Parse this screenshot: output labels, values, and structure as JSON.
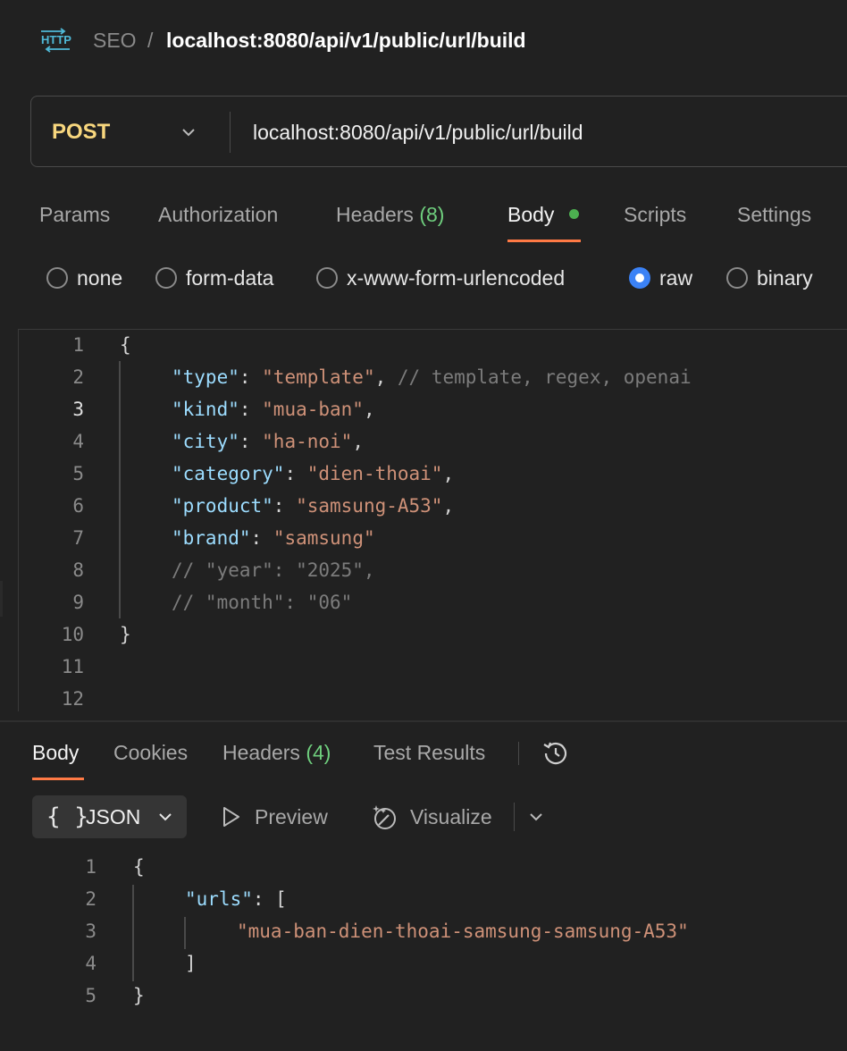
{
  "breadcrumb": {
    "icon_label": "HTTP",
    "parent": "SEO",
    "separator": "/",
    "current": "localhost:8080/api/v1/public/url/build"
  },
  "request": {
    "method": "POST",
    "url": "localhost:8080/api/v1/public/url/build"
  },
  "request_tabs": {
    "params": "Params",
    "authorization": "Authorization",
    "headers_label": "Headers",
    "headers_count": "(8)",
    "body": "Body",
    "scripts": "Scripts",
    "settings": "Settings",
    "active": "Body"
  },
  "body_types": {
    "options": [
      "none",
      "form-data",
      "x-www-form-urlencoded",
      "raw",
      "binary"
    ],
    "selected": "raw"
  },
  "request_body": {
    "line_numbers": [
      "1",
      "2",
      "3",
      "4",
      "5",
      "6",
      "7",
      "8",
      "9",
      "10",
      "11",
      "12"
    ],
    "active_line": "3",
    "lines": [
      [
        [
          "p",
          "{"
        ]
      ],
      [
        [
          "k",
          "\"type\""
        ],
        [
          "p",
          ": "
        ],
        [
          "s",
          "\"template\""
        ],
        [
          "p",
          ", "
        ],
        [
          "c",
          "// template, regex, openai"
        ]
      ],
      [
        [
          "k",
          "\"kind\""
        ],
        [
          "p",
          ": "
        ],
        [
          "s",
          "\"mua-ban\""
        ],
        [
          "p",
          ","
        ]
      ],
      [
        [
          "k",
          "\"city\""
        ],
        [
          "p",
          ": "
        ],
        [
          "s",
          "\"ha-noi\""
        ],
        [
          "p",
          ","
        ]
      ],
      [
        [
          "k",
          "\"category\""
        ],
        [
          "p",
          ": "
        ],
        [
          "s",
          "\"dien-thoai\""
        ],
        [
          "p",
          ","
        ]
      ],
      [
        [
          "k",
          "\"product\""
        ],
        [
          "p",
          ": "
        ],
        [
          "s",
          "\"samsung-A53\""
        ],
        [
          "p",
          ","
        ]
      ],
      [
        [
          "k",
          "\"brand\""
        ],
        [
          "p",
          ": "
        ],
        [
          "s",
          "\"samsung\""
        ]
      ],
      [
        [
          "c",
          "// \"year\": \"2025\","
        ]
      ],
      [
        [
          "c",
          "// \"month\": \"06\""
        ]
      ],
      [
        [
          "p",
          "}"
        ]
      ],
      [],
      []
    ]
  },
  "response_tabs": {
    "body": "Body",
    "cookies": "Cookies",
    "headers_label": "Headers",
    "headers_count": "(4)",
    "test_results": "Test Results",
    "active": "Body"
  },
  "response_toolbar": {
    "format": "JSON",
    "format_icon": "{ }",
    "preview": "Preview",
    "visualize": "Visualize"
  },
  "response_body": {
    "line_numbers": [
      "1",
      "2",
      "3",
      "4",
      "5"
    ],
    "lines": [
      [
        [
          "p",
          "{"
        ]
      ],
      [
        [
          "k",
          "\"urls\""
        ],
        [
          "p",
          ": ["
        ]
      ],
      [
        [
          "s",
          "\"mua-ban-dien-thoai-samsung-samsung-A53\""
        ]
      ],
      [
        [
          "p",
          "]"
        ]
      ],
      [
        [
          "p",
          "}"
        ]
      ]
    ]
  },
  "colors": {
    "background": "#212121",
    "method": "#f8d77e",
    "accent": "#ff7a45",
    "radio_selected": "#3b82f6",
    "count": "#6fcf7e",
    "json_key": "#9cdcfe",
    "json_string": "#ce9178",
    "comment": "#7c7c7c"
  }
}
